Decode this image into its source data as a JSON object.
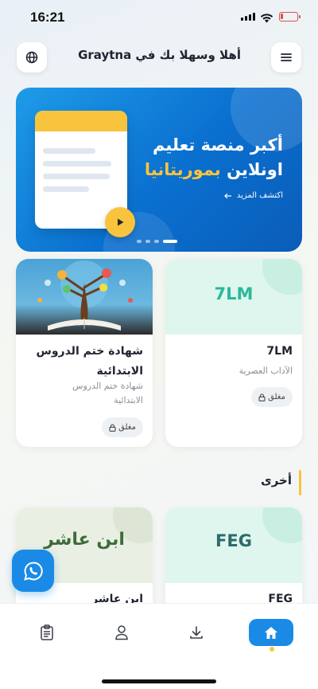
{
  "status_bar": {
    "time": "16:21"
  },
  "header": {
    "greeting": "أهلا وسهلا بك في Graytna"
  },
  "banner": {
    "title_line1": "أكبر منصة تعليم",
    "title_line2_white": "اونلاين ",
    "title_line2_yellow": "بموريتانيا",
    "explore_label": "اكتشف المزيد",
    "dot_count": 4,
    "active_dot": 3
  },
  "cards": [
    {
      "cover_text": "7LM",
      "title": "7LM",
      "subtitle": "الآداب العصرية",
      "status": "مغلق"
    },
    {
      "title_line1": "شهادة ختم الدروس",
      "title_line2": "الابتدائية",
      "subtitle_line1": "شهادة ختم الدروس",
      "subtitle_line2": "الابتدائية",
      "status": "مغلق"
    }
  ],
  "section": {
    "title": "أخرى"
  },
  "other_cards": [
    {
      "cover_text": "FEG",
      "title": "FEG"
    },
    {
      "cover_text": "ابن عاشر",
      "title": "ابن عاشر"
    }
  ],
  "colors": {
    "primary": "#1a8ae6",
    "accent": "#f9c43d",
    "mint": "#2bb89a",
    "sage": "#3f6b3a"
  },
  "bottom_nav": {
    "items": [
      {
        "icon": "clipboard-icon",
        "active": false
      },
      {
        "icon": "user-icon",
        "active": false
      },
      {
        "icon": "download-icon",
        "active": false
      },
      {
        "icon": "home-icon",
        "active": true
      }
    ]
  }
}
